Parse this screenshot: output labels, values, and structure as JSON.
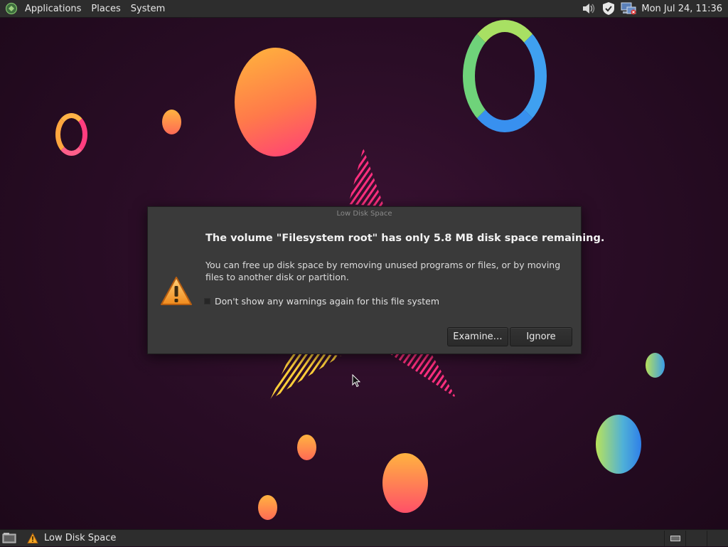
{
  "top_panel": {
    "menus": [
      "Applications",
      "Places",
      "System"
    ],
    "clock": "Mon Jul 24, 11:36",
    "tray_icons": [
      "volume-icon",
      "shield-icon",
      "network-icon"
    ]
  },
  "dialog": {
    "window_title": "Low Disk Space",
    "heading": "The volume \"Filesystem root\" has only 5.8 MB disk space remaining.",
    "body": "You can free up disk space by removing unused programs or files, or by moving files to another disk or partition.",
    "checkbox_label": "Don't show any warnings again for this file system",
    "checkbox_checked": false,
    "buttons": {
      "examine": "Examine…",
      "ignore": "Ignore"
    },
    "icon": "warning-icon"
  },
  "bottom_panel": {
    "task_label": "Low Disk Space",
    "task_icon": "warning-icon",
    "workspaces": 2
  }
}
